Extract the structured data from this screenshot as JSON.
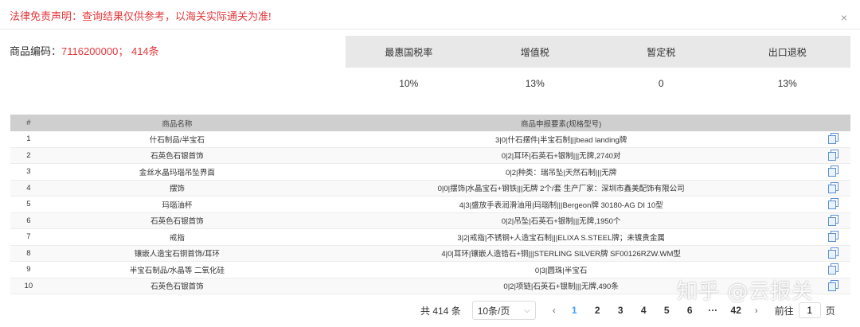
{
  "dialog": {
    "disclaimer": "法律免责声明：查询结果仅供参考，以海关实际通关为准!",
    "close_glyph": "×"
  },
  "commodity": {
    "label": "商品编码：",
    "value": "7116200000；  414条"
  },
  "rates": {
    "headers": [
      "最惠国税率",
      "增值税",
      "暂定税",
      "出口退税"
    ],
    "values": [
      "10%",
      "13%",
      "0",
      "13%"
    ]
  },
  "table": {
    "headers": [
      "#",
      "商品名称",
      "商品申报要素(规格型号)",
      ""
    ],
    "rows": [
      {
        "no": "1",
        "name": "什石制品/半宝石",
        "desc": "3|0|什石摆件|半宝石制|||bead landing牌"
      },
      {
        "no": "2",
        "name": "石英色石银首饰",
        "desc": "0|2|耳环|石英石+银制|||无牌,2740对"
      },
      {
        "no": "3",
        "name": "金丝水晶玛瑙吊坠界面",
        "desc": "0|2|种类：瑞吊坠|天然石制|||无牌"
      },
      {
        "no": "4",
        "name": "摆饰",
        "desc": "0|0|摆饰|水晶宝石+钢铁|||无牌 2个/套 生产厂家：深圳市鑫美配饰有限公司"
      },
      {
        "no": "5",
        "name": "玛瑙油杯",
        "desc": "4|3|盛放手表润滑油用|玛瑙制|||Bergeon牌 30180-AG DI 10型"
      },
      {
        "no": "6",
        "name": "石英色石银首饰",
        "desc": "0|2|吊坠|石英石+银制|||无牌,1950个"
      },
      {
        "no": "7",
        "name": "戒指",
        "desc": "3|2|戒指|不锈钢+人造宝石制|||ELIXA S.STEEL牌；未镀贵金属"
      },
      {
        "no": "8",
        "name": "镶嵌人造宝石铜首饰/耳环",
        "desc": "4|0|耳环|镶嵌人造锆石+铜|||STERLING SILVER牌 SF00126RZW.WM型"
      },
      {
        "no": "9",
        "name": "半宝石制品/水晶等 二氧化硅",
        "desc": "0|3|圆珠|半宝石"
      },
      {
        "no": "10",
        "name": "石英色石银首饰",
        "desc": "0|2|项链|石英石+银制|||无牌,490条"
      }
    ]
  },
  "pagination": {
    "total": "共 414 条",
    "page_size": "10条/页",
    "prev": "‹",
    "pages": [
      "1",
      "2",
      "3",
      "4",
      "5",
      "6",
      "···",
      "42"
    ],
    "next": "›",
    "goto_label": "前往",
    "goto_value": "1",
    "goto_suffix": "页"
  },
  "watermark": "知乎 @云报关",
  "colors": {
    "alert": "#e4393c",
    "accent": "#409eff",
    "header_bg": "#e8e8e8"
  }
}
